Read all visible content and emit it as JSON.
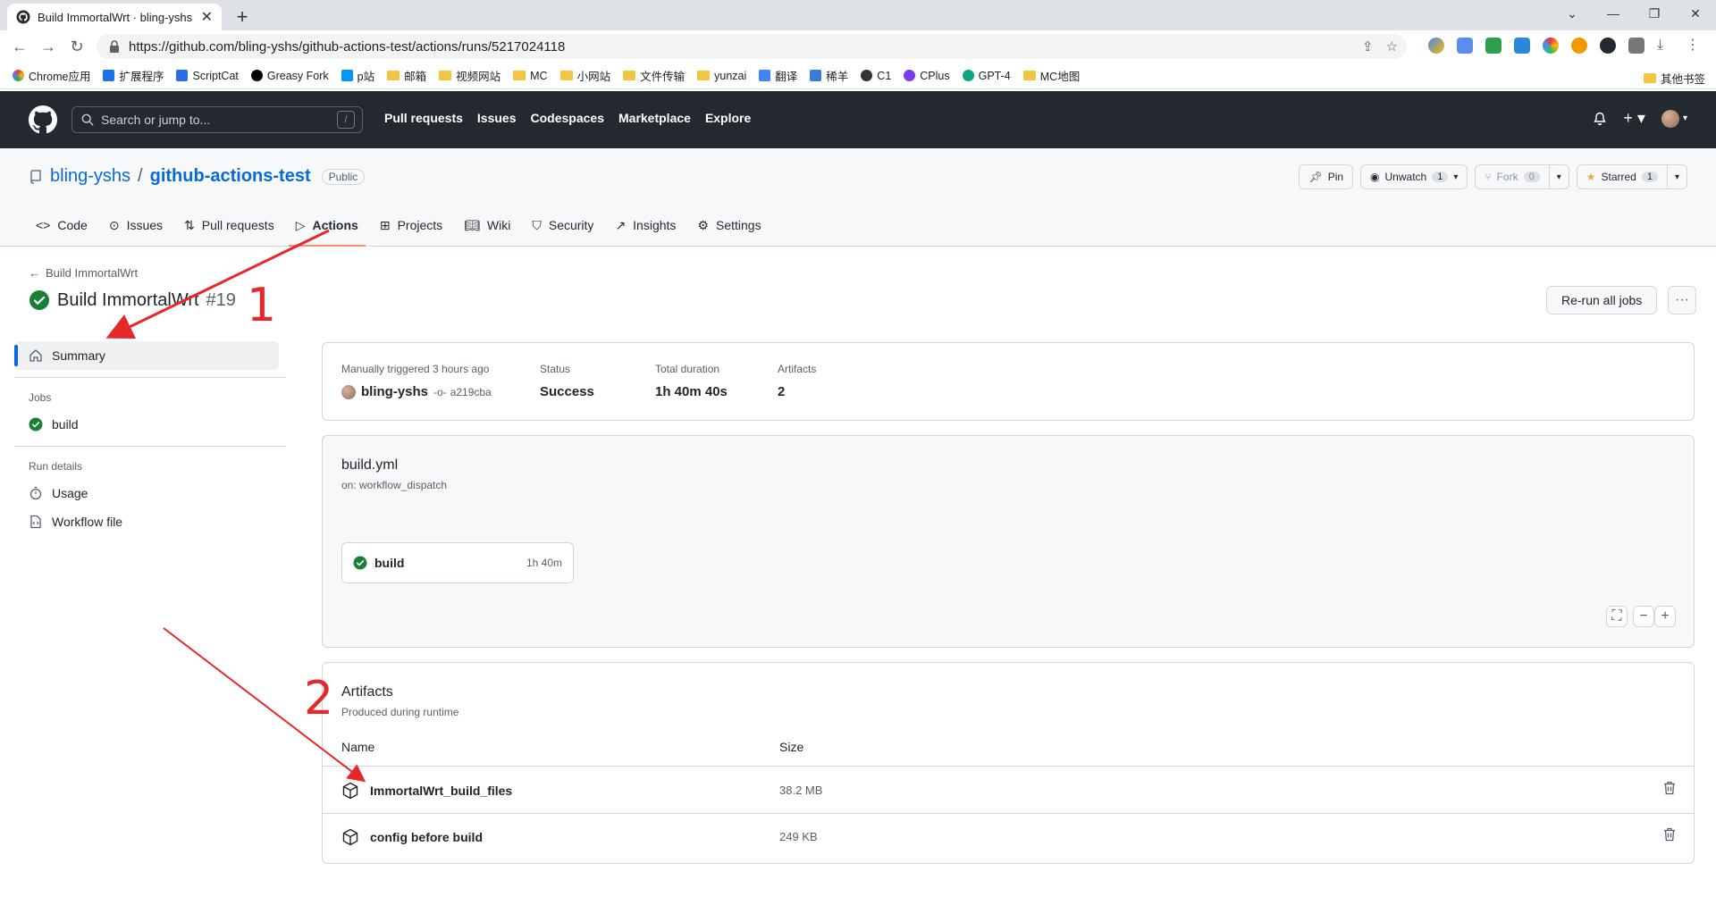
{
  "browser": {
    "tab_title": "Build ImmortalWrt · bling-yshs",
    "url": "https://github.com/bling-yshs/github-actions-test/actions/runs/5217024118",
    "bookmarks": [
      "Chrome应用",
      "扩展程序",
      "ScriptCat",
      "Greasy Fork",
      "p站",
      "邮箱",
      "视频网站",
      "MC",
      "小网站",
      "文件传输",
      "yunzai",
      "翻译",
      "稀羊",
      "C1",
      "CPlus",
      "GPT-4",
      "MC地图"
    ],
    "other_bookmarks": "其他书签"
  },
  "github": {
    "search_placeholder": "Search or jump to...",
    "search_shortcut": "/",
    "nav": [
      "Pull requests",
      "Issues",
      "Codespaces",
      "Marketplace",
      "Explore"
    ]
  },
  "repo": {
    "owner": "bling-yshs",
    "separator": "/",
    "name": "github-actions-test",
    "visibility": "Public",
    "pin_label": "Pin",
    "unwatch_label": "Unwatch",
    "unwatch_count": "1",
    "fork_label": "Fork",
    "fork_count": "0",
    "starred_label": "Starred",
    "starred_count": "1",
    "tabs": [
      "Code",
      "Issues",
      "Pull requests",
      "Actions",
      "Projects",
      "Wiki",
      "Security",
      "Insights",
      "Settings"
    ],
    "active_tab": "Actions"
  },
  "run": {
    "back_label": "Build ImmortalWrt",
    "title": "Build ImmortalWrt",
    "number": "#19",
    "rerun_label": "Re-run all jobs",
    "more_label": "···"
  },
  "sidebar": {
    "summary": "Summary",
    "jobs_heading": "Jobs",
    "jobs": [
      "build"
    ],
    "run_details_heading": "Run details",
    "usage": "Usage",
    "workflow_file": "Workflow file"
  },
  "summary": {
    "trigger_label": "Manually triggered 3 hours ago",
    "actor": "bling-yshs",
    "commit": "a219cba",
    "status_label": "Status",
    "status_value": "Success",
    "duration_label": "Total duration",
    "duration_value": "1h 40m 40s",
    "artifacts_label": "Artifacts",
    "artifacts_value": "2"
  },
  "workflow": {
    "file": "build.yml",
    "trigger": "on: workflow_dispatch",
    "job_name": "build",
    "job_duration": "1h 40m"
  },
  "artifacts": {
    "title": "Artifacts",
    "subtitle": "Produced during runtime",
    "col_name": "Name",
    "col_size": "Size",
    "items": [
      {
        "name": "ImmortalWrt_build_files",
        "size": "38.2 MB"
      },
      {
        "name": "config before build",
        "size": "249 KB"
      }
    ]
  },
  "annotations": {
    "label_1": "1",
    "label_2": "2",
    "color": "#e8272b"
  },
  "colors": {
    "accent": "#0969da",
    "success": "#1a7f37",
    "header_bg": "#24292f",
    "active_tab_underline": "#fd8c73"
  }
}
